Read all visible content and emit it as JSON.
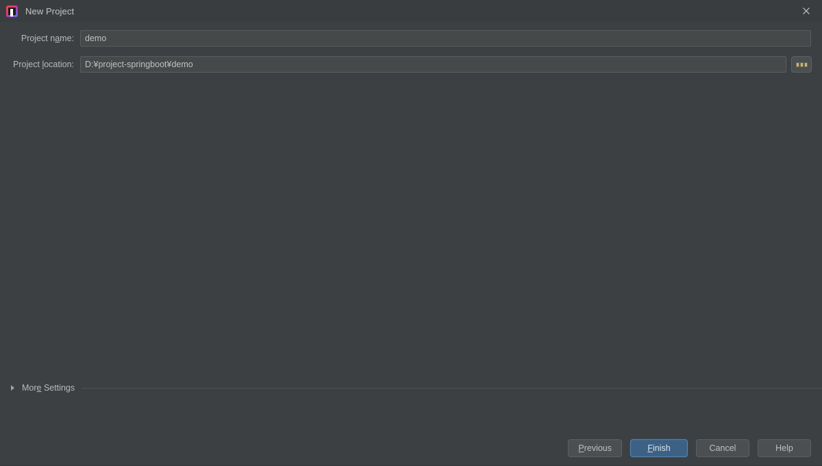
{
  "window": {
    "title": "New Project",
    "icon": "intellij-idea-icon",
    "close_icon": "close-icon",
    "colors": {
      "titlebar_bg": "#3a3d3f",
      "body_bg": "#3c4043",
      "field_bg": "#45494a",
      "field_border": "#5a5d5f",
      "button_bg": "#4b4f51",
      "default_button_bg": "#3d6185",
      "default_button_border": "#5b85ad",
      "text": "#b9b9b9",
      "separator": "#4e5254"
    }
  },
  "form": {
    "fields": [
      {
        "label_before": "Project n",
        "label_mnemonic": "a",
        "label_after": "me:",
        "value": "demo",
        "placeholder": ""
      },
      {
        "label_before": "Project ",
        "label_mnemonic": "l",
        "label_after": "ocation:",
        "value": "D:¥project-springboot¥demo",
        "placeholder": ""
      }
    ],
    "browse_button": {
      "label": "...",
      "icon": "ellipsis-icon"
    }
  },
  "more_settings": {
    "expander_icon": "triangle-right-icon",
    "label_before": "Mor",
    "label_mnemonic": "e",
    "label_after": " Settings",
    "expanded": "false"
  },
  "footer": {
    "buttons": [
      {
        "name": "previous",
        "before": "",
        "mnemonic": "P",
        "after": "revious",
        "default": "false"
      },
      {
        "name": "finish",
        "before": "",
        "mnemonic": "F",
        "after": "inish",
        "default": "true"
      },
      {
        "name": "cancel",
        "before": "Cancel",
        "mnemonic": "",
        "after": "",
        "default": "false"
      },
      {
        "name": "help",
        "before": "Help",
        "mnemonic": "",
        "after": "",
        "default": "false"
      }
    ]
  }
}
